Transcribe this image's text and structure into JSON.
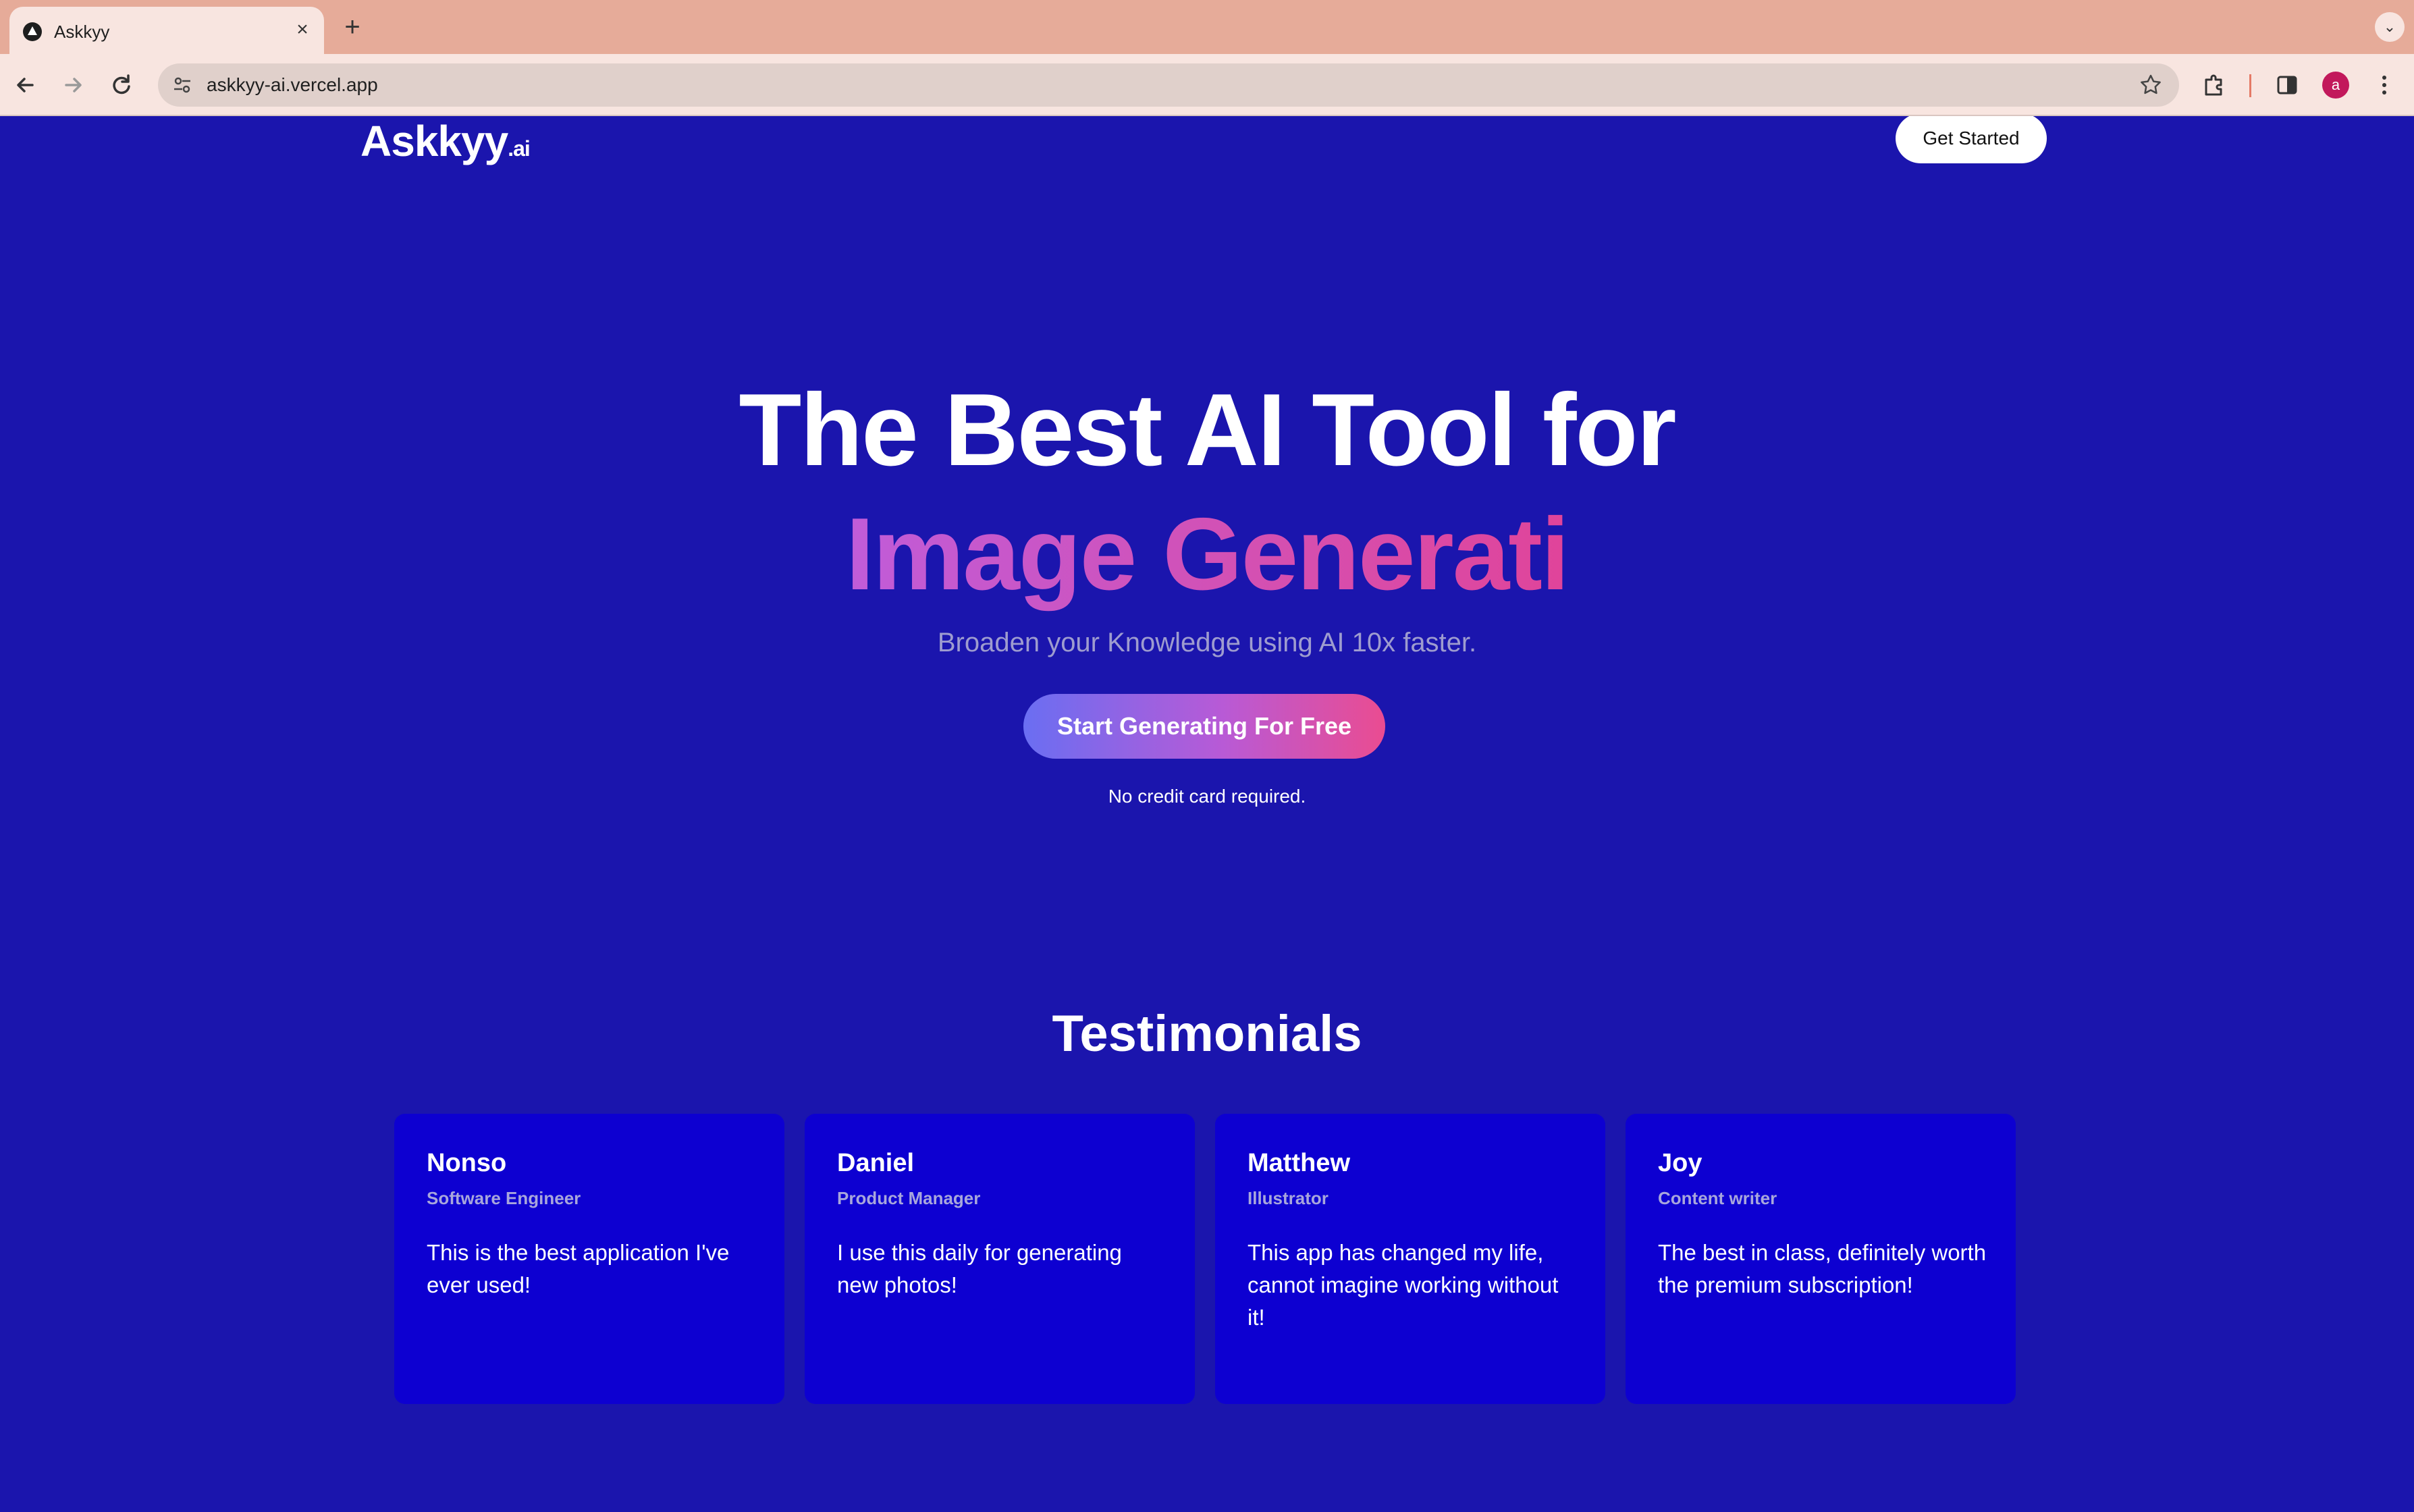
{
  "browser": {
    "tab_title": "Askkyy",
    "tab_close": "×",
    "new_tab": "+",
    "tab_menu": "⌄",
    "url": "askkyy-ai.vercel.app",
    "profile_initial": "a"
  },
  "header": {
    "logo_main": "Askkyy",
    "logo_suffix": ".ai",
    "cta_label": "Get Started"
  },
  "hero": {
    "line1": "The Best AI Tool for",
    "line2": "Image Generati",
    "subtitle": "Broaden your Knowledge using AI 10x faster.",
    "cta_label": "Start Generating For Free",
    "note": "No credit card required."
  },
  "testimonials": {
    "title": "Testimonials",
    "items": [
      {
        "name": "Nonso",
        "role": "Software Engineer",
        "quote": "This is the best application I've ever used!"
      },
      {
        "name": "Daniel",
        "role": "Product Manager",
        "quote": "I use this daily for generating new photos!"
      },
      {
        "name": "Matthew",
        "role": "Illustrator",
        "quote": "This app has changed my life, cannot imagine working without it!"
      },
      {
        "name": "Joy",
        "role": "Content writer",
        "quote": "The best in class, definitely worth the premium subscription!"
      }
    ]
  },
  "colors": {
    "page_background": "#1b15ad",
    "card_background": "#0d00d1",
    "gradient_start": "#6a6ef2",
    "gradient_end": "#ea4c91",
    "browser_tabbar": "#e6ab99",
    "browser_toolbar": "#f8e5e0"
  },
  "icons": [
    "back-arrow-icon",
    "forward-arrow-icon",
    "reload-icon",
    "site-settings-icon",
    "star-icon",
    "extensions-icon",
    "side-panel-icon",
    "more-menu-icon",
    "close-icon",
    "plus-icon",
    "chevron-down-icon"
  ]
}
